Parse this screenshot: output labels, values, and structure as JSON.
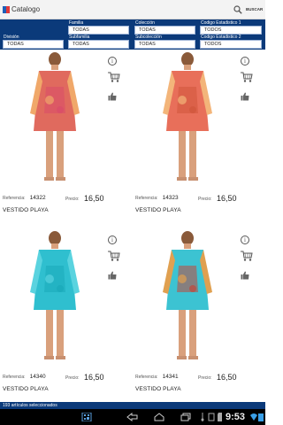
{
  "app": {
    "title": "Catalogo",
    "search_label": "BUSCAR"
  },
  "filters": {
    "division": {
      "label": "División",
      "value": "TODAS"
    },
    "familia": {
      "label": "Familia",
      "value": "TODAS"
    },
    "subfamilia": {
      "label": "Subfamilia",
      "value": "TODAS"
    },
    "coleccion": {
      "label": "Colección",
      "value": "TODAS"
    },
    "subcoleccion": {
      "label": "Subcolección",
      "value": "TODAS"
    },
    "codigo1": {
      "label": "Codigo Estadistico 1",
      "value": "TODOS"
    },
    "codigo2": {
      "label": "Codigo Estadistico 2",
      "value": "TODOS"
    }
  },
  "labels": {
    "reference": "Referencia:",
    "price": "Precio:"
  },
  "products": [
    {
      "reference": "14322",
      "price": "16,50",
      "description": "VESTIDO PLAYA",
      "colors": [
        "#e06a5e",
        "#f0a86a",
        "#d94b6a"
      ]
    },
    {
      "reference": "14323",
      "price": "16,50",
      "description": "VESTIDO PLAYA",
      "colors": [
        "#e86f5a",
        "#f3b57a",
        "#d0563c"
      ]
    },
    {
      "reference": "14340",
      "price": "16,50",
      "description": "VESTIDO PLAYA",
      "colors": [
        "#2fbfcf",
        "#5ad3df",
        "#1aa9b9"
      ]
    },
    {
      "reference": "14341",
      "price": "16,50",
      "description": "VESTIDO PLAYA",
      "colors": [
        "#3cc3d2",
        "#e0a050",
        "#c2473a"
      ]
    }
  ],
  "status": {
    "text": "193 artículos seleccionados",
    "clock": "9:53"
  },
  "colors": {
    "brand": "#0b3a7a",
    "statusbar": "#000000"
  }
}
